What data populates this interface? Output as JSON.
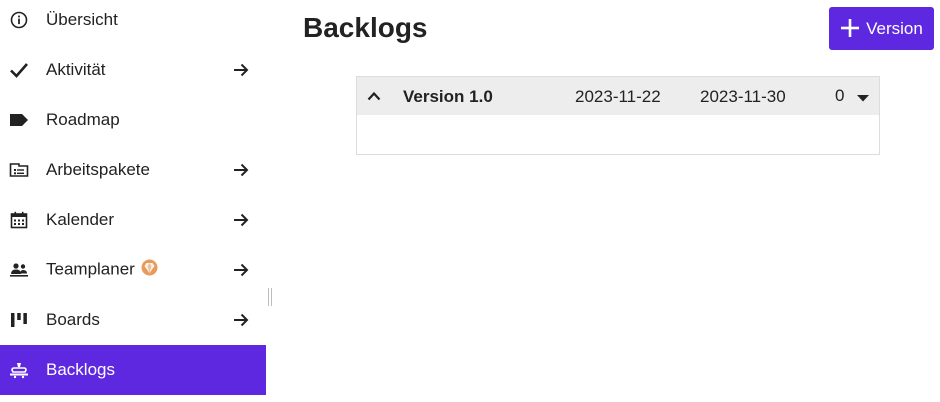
{
  "sidebar": {
    "items": [
      {
        "label": "Übersicht",
        "icon": "info-icon",
        "has_arrow": false
      },
      {
        "label": "Aktivität",
        "icon": "checkmark-icon",
        "has_arrow": true
      },
      {
        "label": "Roadmap",
        "icon": "tag-icon",
        "has_arrow": false
      },
      {
        "label": "Arbeitspakete",
        "icon": "work-packages-icon",
        "has_arrow": true
      },
      {
        "label": "Kalender",
        "icon": "calendar-icon",
        "has_arrow": true
      },
      {
        "label": "Teamplaner",
        "icon": "team-planner-icon",
        "has_arrow": true,
        "badge": "enterprise-badge-icon"
      },
      {
        "label": "Boards",
        "icon": "boards-icon",
        "has_arrow": true
      },
      {
        "label": "Backlogs",
        "icon": "backlogs-icon",
        "has_arrow": false,
        "active": true
      }
    ]
  },
  "main": {
    "title": "Backlogs",
    "add_button_label": "Version",
    "backlog": {
      "version_name": "Version 1.0",
      "start_date": "2023-11-22",
      "end_date": "2023-11-30",
      "points": "0"
    }
  },
  "colors": {
    "accent": "#5e27e0",
    "header_bg": "#ededed",
    "badge": "#e89b5a"
  }
}
